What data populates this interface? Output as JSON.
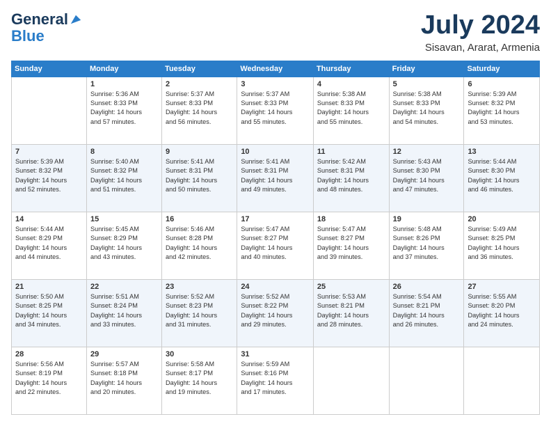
{
  "logo": {
    "line1": "General",
    "line2": "Blue"
  },
  "title": "July 2024",
  "location": "Sisavan, Ararat, Armenia",
  "weekdays": [
    "Sunday",
    "Monday",
    "Tuesday",
    "Wednesday",
    "Thursday",
    "Friday",
    "Saturday"
  ],
  "weeks": [
    [
      {
        "day": "",
        "info": ""
      },
      {
        "day": "1",
        "info": "Sunrise: 5:36 AM\nSunset: 8:33 PM\nDaylight: 14 hours\nand 57 minutes."
      },
      {
        "day": "2",
        "info": "Sunrise: 5:37 AM\nSunset: 8:33 PM\nDaylight: 14 hours\nand 56 minutes."
      },
      {
        "day": "3",
        "info": "Sunrise: 5:37 AM\nSunset: 8:33 PM\nDaylight: 14 hours\nand 55 minutes."
      },
      {
        "day": "4",
        "info": "Sunrise: 5:38 AM\nSunset: 8:33 PM\nDaylight: 14 hours\nand 55 minutes."
      },
      {
        "day": "5",
        "info": "Sunrise: 5:38 AM\nSunset: 8:33 PM\nDaylight: 14 hours\nand 54 minutes."
      },
      {
        "day": "6",
        "info": "Sunrise: 5:39 AM\nSunset: 8:32 PM\nDaylight: 14 hours\nand 53 minutes."
      }
    ],
    [
      {
        "day": "7",
        "info": "Sunrise: 5:39 AM\nSunset: 8:32 PM\nDaylight: 14 hours\nand 52 minutes."
      },
      {
        "day": "8",
        "info": "Sunrise: 5:40 AM\nSunset: 8:32 PM\nDaylight: 14 hours\nand 51 minutes."
      },
      {
        "day": "9",
        "info": "Sunrise: 5:41 AM\nSunset: 8:31 PM\nDaylight: 14 hours\nand 50 minutes."
      },
      {
        "day": "10",
        "info": "Sunrise: 5:41 AM\nSunset: 8:31 PM\nDaylight: 14 hours\nand 49 minutes."
      },
      {
        "day": "11",
        "info": "Sunrise: 5:42 AM\nSunset: 8:31 PM\nDaylight: 14 hours\nand 48 minutes."
      },
      {
        "day": "12",
        "info": "Sunrise: 5:43 AM\nSunset: 8:30 PM\nDaylight: 14 hours\nand 47 minutes."
      },
      {
        "day": "13",
        "info": "Sunrise: 5:44 AM\nSunset: 8:30 PM\nDaylight: 14 hours\nand 46 minutes."
      }
    ],
    [
      {
        "day": "14",
        "info": "Sunrise: 5:44 AM\nSunset: 8:29 PM\nDaylight: 14 hours\nand 44 minutes."
      },
      {
        "day": "15",
        "info": "Sunrise: 5:45 AM\nSunset: 8:29 PM\nDaylight: 14 hours\nand 43 minutes."
      },
      {
        "day": "16",
        "info": "Sunrise: 5:46 AM\nSunset: 8:28 PM\nDaylight: 14 hours\nand 42 minutes."
      },
      {
        "day": "17",
        "info": "Sunrise: 5:47 AM\nSunset: 8:27 PM\nDaylight: 14 hours\nand 40 minutes."
      },
      {
        "day": "18",
        "info": "Sunrise: 5:47 AM\nSunset: 8:27 PM\nDaylight: 14 hours\nand 39 minutes."
      },
      {
        "day": "19",
        "info": "Sunrise: 5:48 AM\nSunset: 8:26 PM\nDaylight: 14 hours\nand 37 minutes."
      },
      {
        "day": "20",
        "info": "Sunrise: 5:49 AM\nSunset: 8:25 PM\nDaylight: 14 hours\nand 36 minutes."
      }
    ],
    [
      {
        "day": "21",
        "info": "Sunrise: 5:50 AM\nSunset: 8:25 PM\nDaylight: 14 hours\nand 34 minutes."
      },
      {
        "day": "22",
        "info": "Sunrise: 5:51 AM\nSunset: 8:24 PM\nDaylight: 14 hours\nand 33 minutes."
      },
      {
        "day": "23",
        "info": "Sunrise: 5:52 AM\nSunset: 8:23 PM\nDaylight: 14 hours\nand 31 minutes."
      },
      {
        "day": "24",
        "info": "Sunrise: 5:52 AM\nSunset: 8:22 PM\nDaylight: 14 hours\nand 29 minutes."
      },
      {
        "day": "25",
        "info": "Sunrise: 5:53 AM\nSunset: 8:21 PM\nDaylight: 14 hours\nand 28 minutes."
      },
      {
        "day": "26",
        "info": "Sunrise: 5:54 AM\nSunset: 8:21 PM\nDaylight: 14 hours\nand 26 minutes."
      },
      {
        "day": "27",
        "info": "Sunrise: 5:55 AM\nSunset: 8:20 PM\nDaylight: 14 hours\nand 24 minutes."
      }
    ],
    [
      {
        "day": "28",
        "info": "Sunrise: 5:56 AM\nSunset: 8:19 PM\nDaylight: 14 hours\nand 22 minutes."
      },
      {
        "day": "29",
        "info": "Sunrise: 5:57 AM\nSunset: 8:18 PM\nDaylight: 14 hours\nand 20 minutes."
      },
      {
        "day": "30",
        "info": "Sunrise: 5:58 AM\nSunset: 8:17 PM\nDaylight: 14 hours\nand 19 minutes."
      },
      {
        "day": "31",
        "info": "Sunrise: 5:59 AM\nSunset: 8:16 PM\nDaylight: 14 hours\nand 17 minutes."
      },
      {
        "day": "",
        "info": ""
      },
      {
        "day": "",
        "info": ""
      },
      {
        "day": "",
        "info": ""
      }
    ]
  ]
}
